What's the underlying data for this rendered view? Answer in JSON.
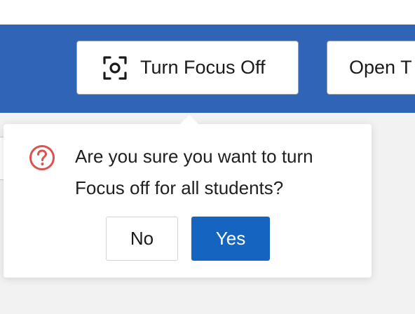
{
  "toolbar": {
    "focus_button_label": "Turn Focus Off",
    "focus_icon": "focus-icon",
    "open_button_label": "Open T"
  },
  "popover": {
    "message": "Are you sure you want to turn Focus off for all students?",
    "icon": "question-icon",
    "no_label": "No",
    "yes_label": "Yes"
  },
  "colors": {
    "toolbar_bg": "#2f64b6",
    "primary_button": "#1565c0",
    "warning_icon": "#d9534f"
  }
}
